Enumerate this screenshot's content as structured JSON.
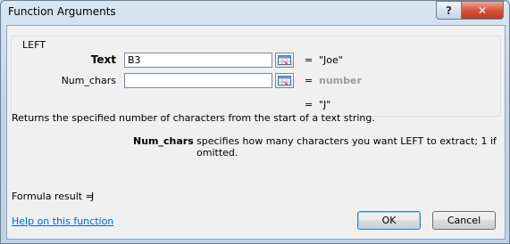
{
  "window": {
    "title": "Function Arguments"
  },
  "title_buttons": {
    "help_glyph": "?",
    "close_glyph": "✕"
  },
  "function_group": {
    "name": "LEFT"
  },
  "arguments": [
    {
      "label": "Text",
      "value": "B3",
      "equals": "=",
      "result": "\"Joe\""
    },
    {
      "label": "Num_chars",
      "value": "",
      "equals": "=",
      "result": "number"
    }
  ],
  "formula_value": {
    "equals": "=",
    "value": "\"J\""
  },
  "description": "Returns the specified number of characters from the start of a text string.",
  "arg_help": {
    "name": "Num_chars",
    "text": "specifies how many characters you want LEFT to extract; 1 if omitted."
  },
  "formula_result": {
    "label": "Formula result =",
    "value": "J"
  },
  "help_link": "Help on this function",
  "buttons": {
    "ok": "OK",
    "cancel": "Cancel"
  },
  "colors": {
    "link": "#0066cc",
    "close_button": "#c1371d",
    "hint_text": "#9a9a9a"
  }
}
